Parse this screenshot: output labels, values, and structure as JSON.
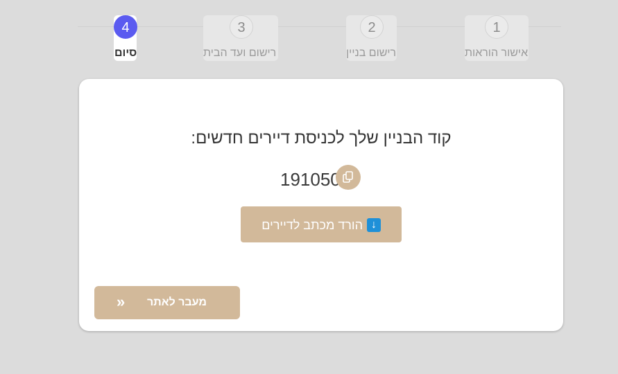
{
  "stepper": {
    "steps": [
      {
        "number": "1",
        "label": "אישור הוראות",
        "state": "inactive"
      },
      {
        "number": "2",
        "label": "רישום בניין",
        "state": "inactive"
      },
      {
        "number": "3",
        "label": "רישום ועד הבית",
        "state": "inactive"
      },
      {
        "number": "4",
        "label": "סיום",
        "state": "active"
      }
    ]
  },
  "card": {
    "code_title": "קוד הבניין שלך לכניסת דיירים חדשים:",
    "code_value": "191050",
    "copy_icon": "copy-icon",
    "download_label": "הורד מכתב לדיירים",
    "download_icon": "download-arrow-icon",
    "goto_label": "מעבר לאתר",
    "goto_icon": "double-chevron-right-icon"
  },
  "colors": {
    "background": "#dcdcdc",
    "accent": "#d2b99a",
    "active_step": "#5b5bf0",
    "download_icon_bg": "#1e90d8"
  }
}
